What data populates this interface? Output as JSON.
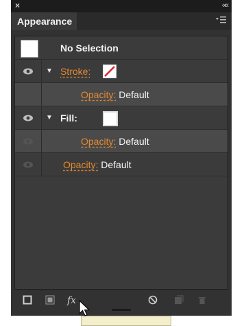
{
  "window": {
    "close_glyph": "×",
    "collapse_glyph": "««"
  },
  "panel": {
    "tab_label": "Appearance",
    "menu_glyph": "≡"
  },
  "rows": {
    "selection": {
      "label": "No Selection"
    },
    "stroke": {
      "label": "Stroke:",
      "swatch": "none-with-red-slash"
    },
    "stroke_opacity": {
      "label": "Opacity:",
      "value": "Default"
    },
    "fill": {
      "label": "Fill:",
      "swatch": "white"
    },
    "fill_opacity": {
      "label": "Opacity:",
      "value": "Default"
    },
    "object_opacity": {
      "label": "Opacity:",
      "value": "Default"
    }
  },
  "bottom_icons": [
    "add-new-stroke-icon",
    "add-new-fill-icon",
    "add-new-effect-icon",
    "clear-appearance-icon",
    "duplicate-item-icon",
    "delete-item-icon"
  ],
  "bottom": {
    "fx_label": "fx"
  },
  "colors": {
    "accent": "#e6892d",
    "panel": "#323232",
    "row": "#3b3b3b",
    "row_selected": "#4a4a4a"
  }
}
